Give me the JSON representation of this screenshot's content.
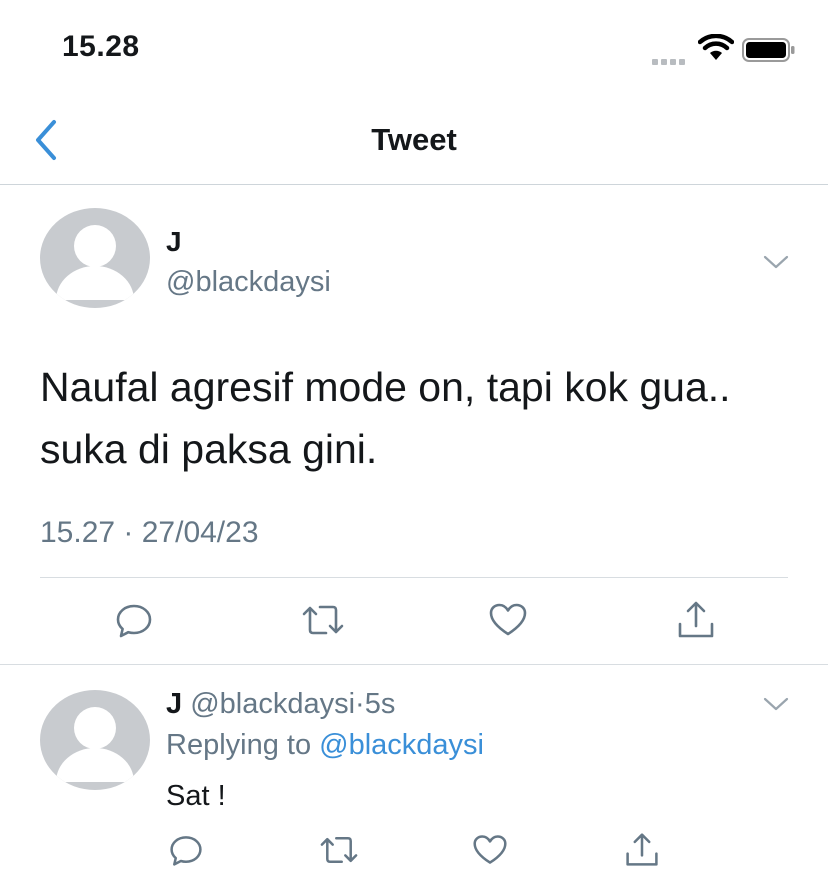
{
  "status_bar": {
    "time": "15.28"
  },
  "nav": {
    "title": "Tweet"
  },
  "main_tweet": {
    "display_name": "J",
    "handle": "@blackdaysi",
    "text_line1": "Naufal agresif mode on, tapi kok gua..",
    "text_line2": "suka di paksa gini.",
    "timestamp": "15.27 · 27/04/23",
    "actions": [
      "reply-icon",
      "retweet-icon",
      "like-icon",
      "share-icon"
    ]
  },
  "reply": {
    "display_name": "J",
    "handle": "@blackdaysi",
    "separator": "·",
    "age": "5s",
    "replying_prefix": "Replying to ",
    "replying_handle": "@blackdaysi",
    "text": "Sat !"
  },
  "colors": {
    "accent": "#3a8fd8",
    "secondary_text": "#657786",
    "divider": "#d8dde1"
  }
}
